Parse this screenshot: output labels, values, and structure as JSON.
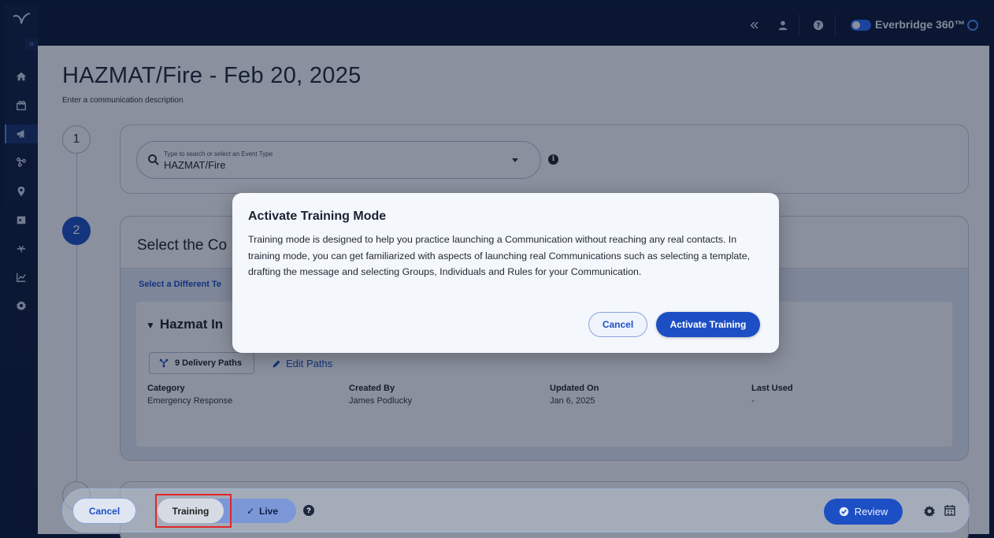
{
  "topbar": {
    "brand": "Everbridge 360™"
  },
  "page": {
    "title": "HAZMAT/Fire - Feb 20, 2025",
    "subtitle": "Enter a communication description"
  },
  "steps": {
    "step1": "1",
    "step2": "2"
  },
  "event_type": {
    "placeholder": "Type to search or select an Event Type",
    "value": "HAZMAT/Fire"
  },
  "template_section": {
    "title": "Select the Co",
    "different_link": "Select a Different Te",
    "template_name": "Hazmat In",
    "delivery_paths": "9 Delivery Paths",
    "edit_paths": "Edit Paths",
    "meta": [
      {
        "label": "Category",
        "value": "Emergency Response"
      },
      {
        "label": "Created By",
        "value": "James Podlucky"
      },
      {
        "label": "Updated On",
        "value": "Jan 6, 2025"
      },
      {
        "label": "Last Used",
        "value": "-"
      }
    ]
  },
  "bottombar": {
    "cancel": "Cancel",
    "training": "Training",
    "live": "Live",
    "review": "Review"
  },
  "modal": {
    "title": "Activate Training Mode",
    "body": "Training mode is designed to help you practice launching a Communication without reaching any real contacts. In training mode, you can get familiarized with aspects of launching real Communications such as selecting a template, drafting the message and selecting Groups, Individuals and Rules for your Communication.",
    "cancel": "Cancel",
    "activate": "Activate Training"
  },
  "icons": {
    "rail": [
      "home-icon",
      "map-people-icon",
      "megaphone-icon",
      "people-network-icon",
      "location-pin-icon",
      "calendar-day-icon",
      "integration-icon",
      "analytics-icon",
      "settings-icon"
    ],
    "topbar": [
      "collapse-icon",
      "user-icon",
      "help-icon"
    ]
  },
  "colors": {
    "primary": "#1d4fc4",
    "nav_bg": "#0b1633",
    "highlight": "#e0262b"
  }
}
